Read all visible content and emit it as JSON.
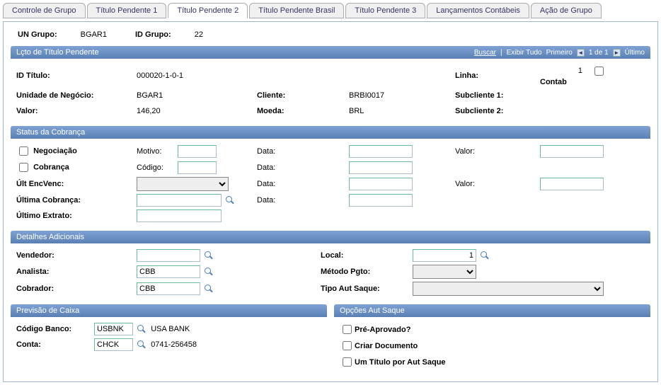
{
  "tabs": {
    "t0": "Controle de Grupo",
    "t1": "Título Pendente 1",
    "t2": "Título Pendente 2",
    "t3": "Título Pendente Brasil",
    "t4": "Título Pendente 3",
    "t5": "Lançamentos Contábeis",
    "t6": "Ação de Grupo"
  },
  "top": {
    "un_grupo_label": "UN Grupo:",
    "un_grupo_value": "BGAR1",
    "id_grupo_label": "ID Grupo:",
    "id_grupo_value": "22"
  },
  "lcto": {
    "title": "Lçto de Título Pendente",
    "nav": {
      "buscar": "Buscar",
      "exibir_tudo": "Exibir Tudo",
      "primeiro": "Primeiro",
      "de": "1 de 1",
      "ultimo": "Último"
    },
    "id_titulo_label": "ID Título:",
    "id_titulo_value": "000020-1-0-1",
    "linha_label": "Linha:",
    "linha_value": "1",
    "contab_label": "Contab",
    "un_label": "Unidade de Negócio:",
    "un_value": "BGAR1",
    "cliente_label": "Cliente:",
    "cliente_value": "BRBI0017",
    "sub1_label": "Subcliente 1:",
    "valor_label": "Valor:",
    "valor_value": "146,20",
    "moeda_label": "Moeda:",
    "moeda_value": "BRL",
    "sub2_label": "Subcliente 2:"
  },
  "status": {
    "title": "Status da Cobrança",
    "negociacao": "Negociação",
    "cobranca": "Cobrança",
    "ult_enc": "Últ EncVenc:",
    "ult_cobr": "Última Cobrança:",
    "ult_extr": "Último Extrato:",
    "motivo": "Motivo:",
    "codigo": "Código:",
    "data": "Data:",
    "valor": "Valor:"
  },
  "detalhes": {
    "title": "Detalhes Adicionais",
    "vendedor": "Vendedor:",
    "analista": "Analista:",
    "analista_value": "CBB",
    "cobrador": "Cobrador:",
    "cobrador_value": "CBB",
    "local": "Local:",
    "local_value": "1",
    "metodo": "Método Pgto:",
    "tipo_aut": "Tipo Aut Saque:"
  },
  "previsao": {
    "title": "Previsão de Caixa",
    "codigo_banco": "Código Banco:",
    "codigo_banco_value": "USBNK",
    "codigo_banco_desc": "USA BANK",
    "conta": "Conta:",
    "conta_value": "CHCK",
    "conta_desc": "0741-256458"
  },
  "opcoes": {
    "title": "Opções Aut Saque",
    "pre": "Pré-Aprovado?",
    "criar": "Criar Documento",
    "umtitulo": "Um Título por Aut Saque"
  }
}
